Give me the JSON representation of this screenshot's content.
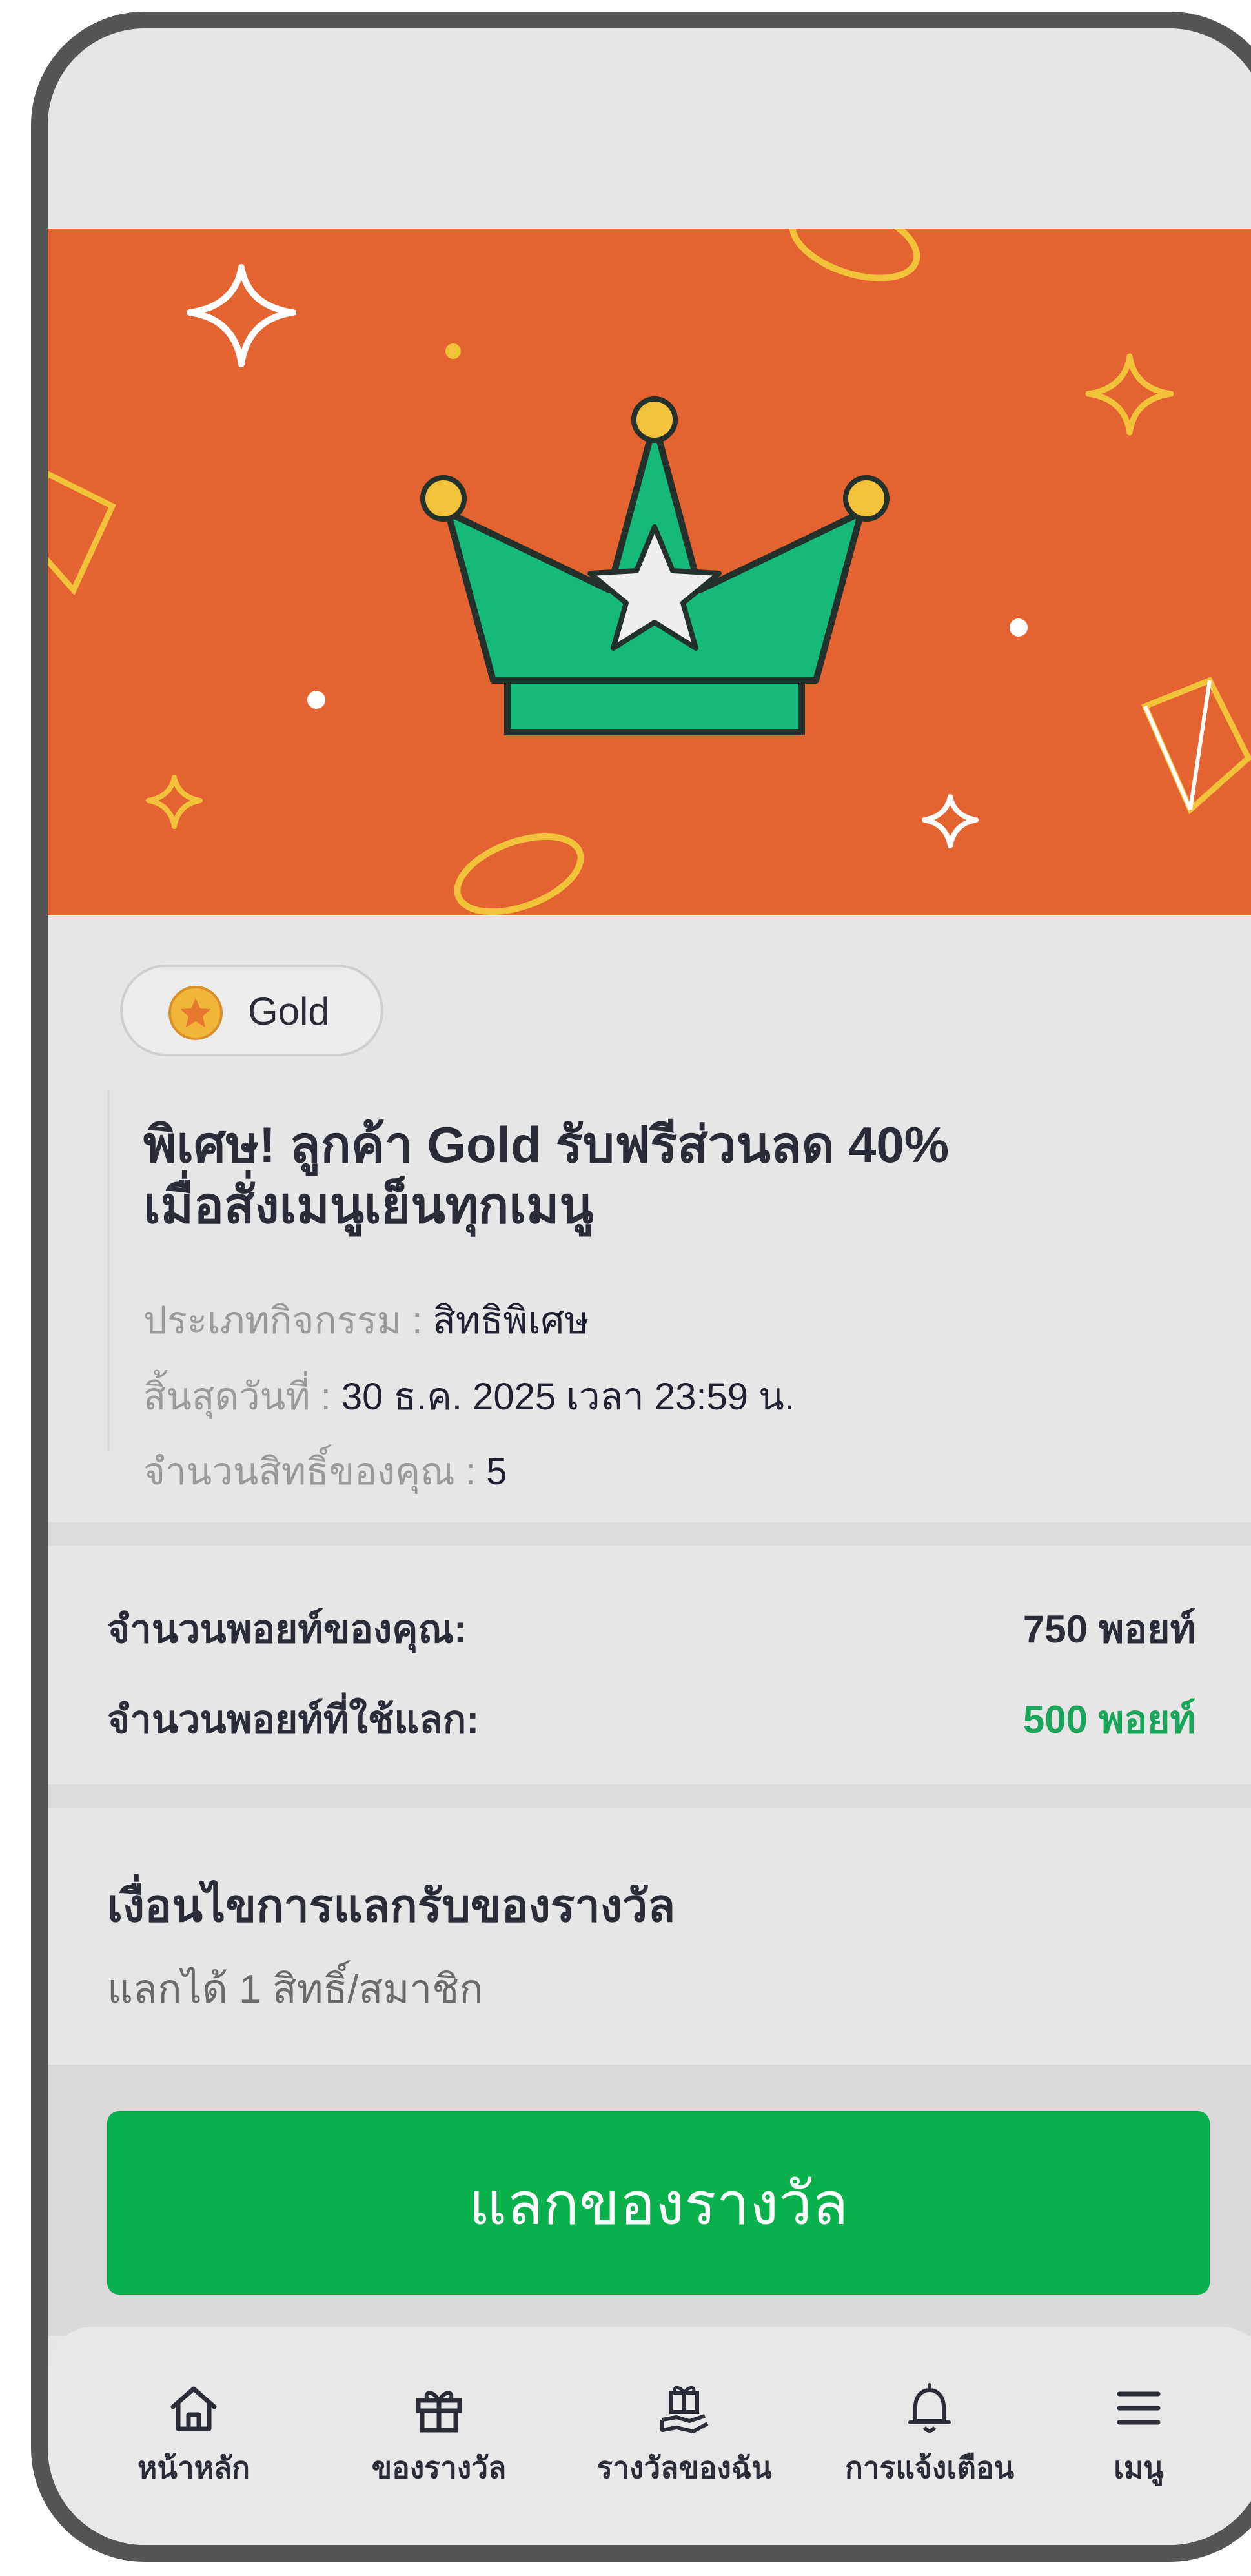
{
  "reward": {
    "tier_badge": "Gold",
    "title_line1": "พิเศษ! ลูกค้า Gold รับฟรีส่วนลด 40%",
    "title_line2": "เมื่อสั่งเมนูเย็นทุกเมนู",
    "category_label": "ประเภทกิจกรรม : ",
    "category_value": "สิทธิพิเศษ",
    "end_date_label": "สิ้นสุดวันที่ : ",
    "end_date_value": "30 ธ.ค. 2025 เวลา 23:59 น.",
    "rights_label": "จำนวนสิทธิ์ของคุณ : ",
    "rights_value": "5"
  },
  "points": {
    "your_points_label": "จำนวนพอยท์ของคุณ:",
    "your_points_value": "750 พอยท์",
    "redeem_points_label": "จำนวนพอยท์ที่ใช้แลก:",
    "redeem_points_value": "500 พอยท์"
  },
  "conditions": {
    "title": "เงื่อนไขการแลกรับของรางวัล",
    "text": "แลกได้ 1 สิทธิ์/สมาชิก"
  },
  "cta": {
    "label": "แลกของรางวัล"
  },
  "nav": {
    "items": [
      {
        "label": "หน้าหลัก",
        "icon": "home-icon"
      },
      {
        "label": "ของรางวัล",
        "icon": "gift-icon"
      },
      {
        "label": "รางวัลของฉัน",
        "icon": "my-rewards-icon"
      },
      {
        "label": "การแจ้งเตือน",
        "icon": "bell-icon"
      },
      {
        "label": "เมนู",
        "icon": "menu-icon"
      }
    ]
  },
  "colors": {
    "banner": "#e36430",
    "crown": "#15b97a",
    "accent_green": "#19a65a",
    "cta": "#08b14c",
    "frame": "#555555"
  }
}
